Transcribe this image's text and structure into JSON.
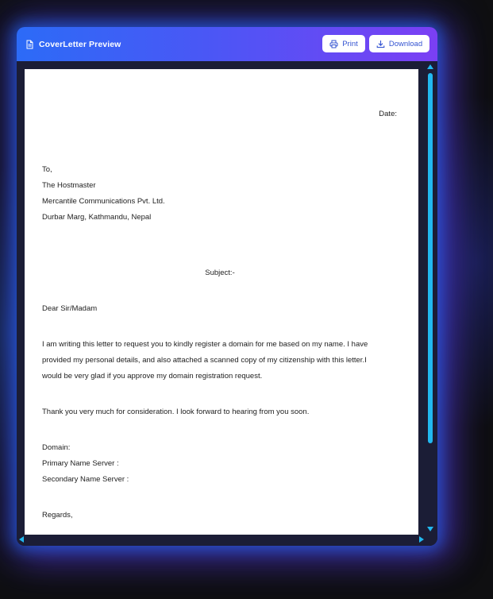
{
  "window": {
    "title": "CoverLetter Preview",
    "title_icon": "document-icon",
    "print_label": "Print",
    "print_icon": "printer-icon",
    "download_label": "Download",
    "download_icon": "download-icon"
  },
  "letter": {
    "date_label": "Date:",
    "recipient_lines": [
      "To,",
      "The Hostmaster",
      "Mercantile Communications Pvt. Ltd.",
      "Durbar Marg, Kathmandu, Nepal"
    ],
    "subject_label": "Subject:-",
    "salutation": "Dear Sir/Madam",
    "body_lines": [
      "I am writing this letter to request you to kindly register a domain for me based on my name. I have",
      "provided my personal details, and also attached a scanned copy of my citizenship with this letter.I",
      "would be very glad if you approve my domain registration request."
    ],
    "thanks": "Thank you very much for consideration. I look forward to hearing from you soon.",
    "domain_lines": [
      "Domain:",
      "Primary Name Server :",
      "Secondary Name Server :"
    ],
    "closing": "Regards,"
  },
  "colors": {
    "header_gradient_start": "#2c6bf7",
    "header_gradient_end": "#7b3ff4",
    "button_text": "#3454d1",
    "scrollbar": "#22b8f0",
    "window_bg": "#1b1d36",
    "page_bg": "#0f0f11"
  }
}
